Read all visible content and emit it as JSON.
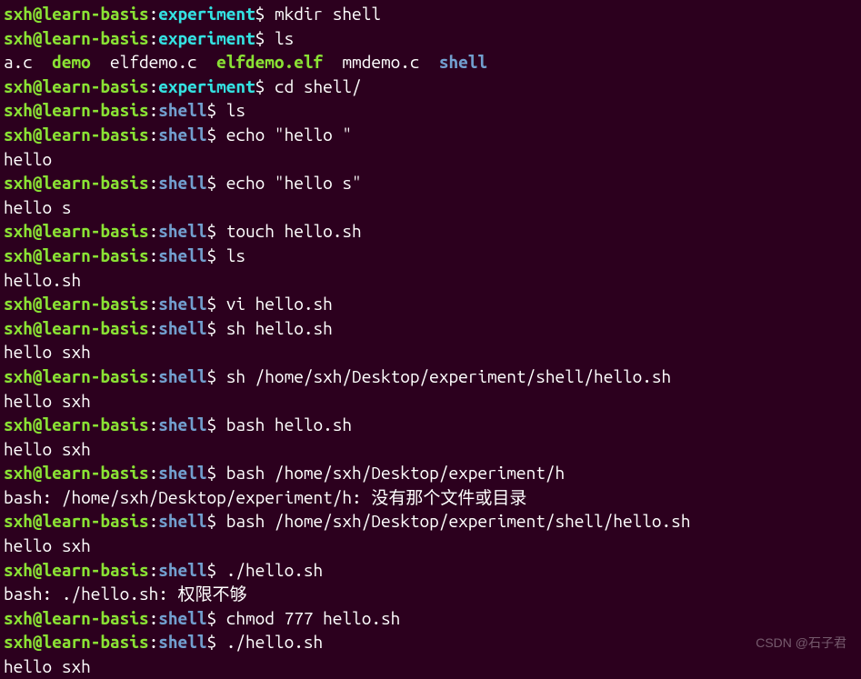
{
  "prompt": {
    "user_host": "sxh@learn-basis",
    "colon": ":",
    "dollar": "$ "
  },
  "paths": {
    "experiment": "experiment",
    "shell": "shell"
  },
  "lines": [
    {
      "type": "prompt",
      "path": "experiment",
      "cmd": "mkdir shell"
    },
    {
      "type": "prompt",
      "path": "experiment",
      "cmd": "ls"
    },
    {
      "type": "ls",
      "items": [
        {
          "text": "a.c",
          "color": "white"
        },
        {
          "text": "demo",
          "color": "green"
        },
        {
          "text": "elfdemo.c",
          "color": "white"
        },
        {
          "text": "elfdemo.elf",
          "color": "green"
        },
        {
          "text": "mmdemo.c",
          "color": "white"
        },
        {
          "text": "shell",
          "color": "blue"
        }
      ]
    },
    {
      "type": "prompt",
      "path": "experiment",
      "cmd": "cd shell/"
    },
    {
      "type": "prompt",
      "path": "shell",
      "cmd": "ls"
    },
    {
      "type": "prompt",
      "path": "shell",
      "cmd": "echo \"hello \""
    },
    {
      "type": "output",
      "text": "hello"
    },
    {
      "type": "prompt",
      "path": "shell",
      "cmd": "echo \"hello s\""
    },
    {
      "type": "output",
      "text": "hello s"
    },
    {
      "type": "prompt",
      "path": "shell",
      "cmd": "touch hello.sh"
    },
    {
      "type": "prompt",
      "path": "shell",
      "cmd": "ls"
    },
    {
      "type": "output",
      "text": "hello.sh"
    },
    {
      "type": "prompt",
      "path": "shell",
      "cmd": "vi hello.sh"
    },
    {
      "type": "prompt",
      "path": "shell",
      "cmd": "sh hello.sh"
    },
    {
      "type": "output",
      "text": "hello sxh"
    },
    {
      "type": "prompt",
      "path": "shell",
      "cmd": "sh /home/sxh/Desktop/experiment/shell/hello.sh"
    },
    {
      "type": "output",
      "text": "hello sxh"
    },
    {
      "type": "prompt",
      "path": "shell",
      "cmd": "bash hello.sh"
    },
    {
      "type": "output",
      "text": "hello sxh"
    },
    {
      "type": "prompt",
      "path": "shell",
      "cmd": "bash /home/sxh/Desktop/experiment/h"
    },
    {
      "type": "output",
      "text": "bash: /home/sxh/Desktop/experiment/h: 没有那个文件或目录"
    },
    {
      "type": "prompt",
      "path": "shell",
      "cmd": "bash /home/sxh/Desktop/experiment/shell/hello.sh"
    },
    {
      "type": "output",
      "text": "hello sxh"
    },
    {
      "type": "prompt",
      "path": "shell",
      "cmd": "./hello.sh"
    },
    {
      "type": "output",
      "text": "bash: ./hello.sh: 权限不够"
    },
    {
      "type": "prompt",
      "path": "shell",
      "cmd": "chmod 777 hello.sh"
    },
    {
      "type": "prompt",
      "path": "shell",
      "cmd": "./hello.sh"
    },
    {
      "type": "output",
      "text": "hello sxh"
    }
  ],
  "watermark": "CSDN @石子君"
}
